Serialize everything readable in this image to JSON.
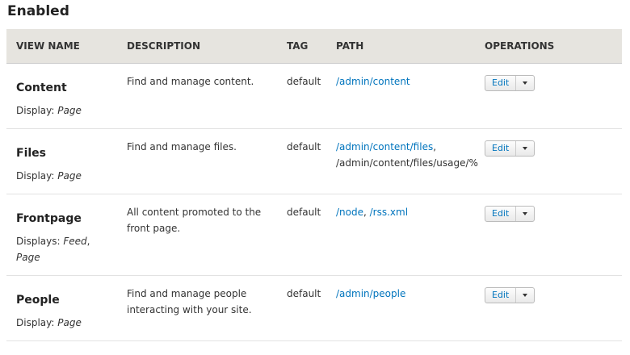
{
  "section_title": "Enabled",
  "columns": [
    "VIEW NAME",
    "DESCRIPTION",
    "TAG",
    "PATH",
    "OPERATIONS"
  ],
  "rows": [
    {
      "name": "Content",
      "display_label": "Display:",
      "displays": "Page",
      "description": "Find and manage content.",
      "tag": "default",
      "path_links": [
        "/admin/content"
      ],
      "path_plain": "",
      "edit_label": "Edit"
    },
    {
      "name": "Files",
      "display_label": "Display:",
      "displays": "Page",
      "description": "Find and manage files.",
      "tag": "default",
      "path_links": [
        "/admin/content/files"
      ],
      "path_plain": "/admin/content/files/usage/%",
      "edit_label": "Edit"
    },
    {
      "name": "Frontpage",
      "display_label": "Displays:",
      "displays": "Feed, Page",
      "display_items": [
        "Feed",
        "Page"
      ],
      "description": "All content promoted to the front page.",
      "tag": "default",
      "path_links": [
        "/node",
        "/rss.xml"
      ],
      "path_plain": "",
      "edit_label": "Edit"
    },
    {
      "name": "People",
      "display_label": "Display:",
      "displays": "Page",
      "description": "Find and manage people interacting with your site.",
      "tag": "default",
      "path_links": [
        "/admin/people"
      ],
      "path_plain": "",
      "edit_label": "Edit"
    }
  ]
}
